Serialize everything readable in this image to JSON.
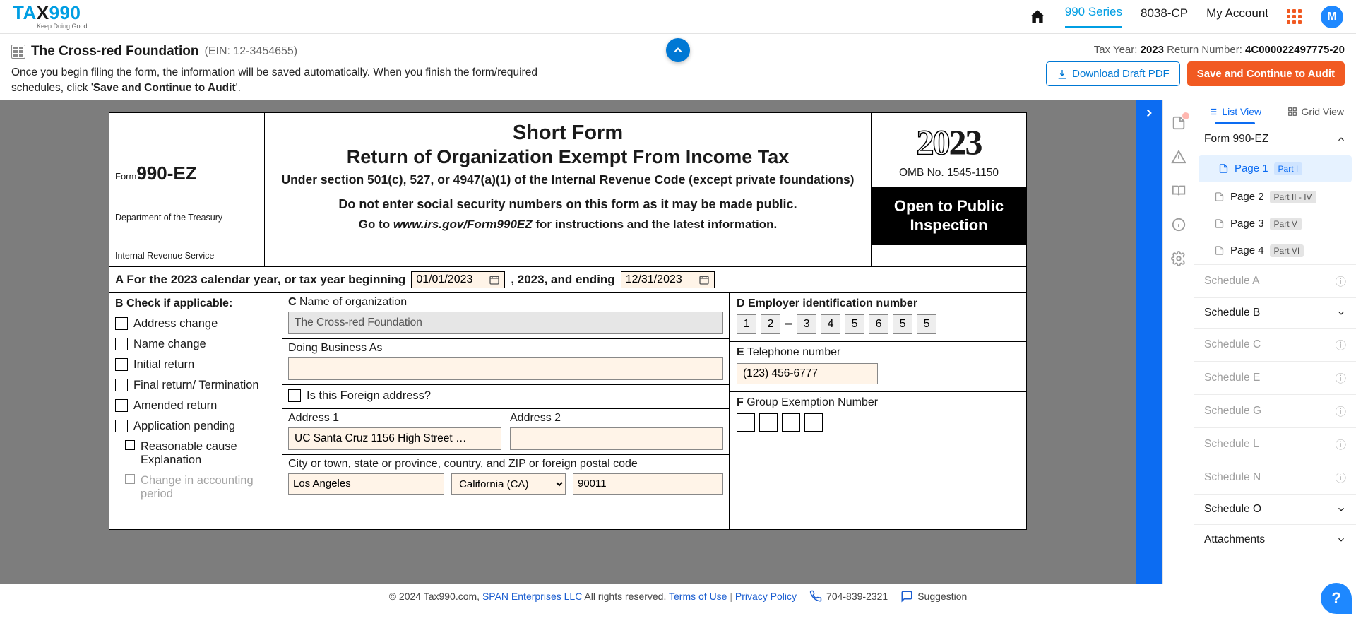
{
  "brand": {
    "name": "TAX990",
    "tagline": "Keep Doing Good"
  },
  "nav": {
    "series": "990 Series",
    "cp": "8038-CP",
    "account": "My Account",
    "avatar_initial": "M"
  },
  "org": {
    "name": "The Cross-red Foundation",
    "ein_display": "(EIN: 12-3454655)"
  },
  "subhead_msg_1": "Once you begin filing the form, the information will be saved automatically. When you finish the form/required schedules, click '",
  "subhead_msg_bold": "Save and Continue to Audit",
  "subhead_msg_2": "'.",
  "meta": {
    "tax_year_label": "Tax Year: ",
    "tax_year": "2023",
    "return_no_label": "  Return Number: ",
    "return_no": "4C000022497775-20"
  },
  "actions": {
    "download": "Download Draft PDF",
    "save": "Save and Continue to Audit"
  },
  "form": {
    "form_label_small": "Form",
    "form_label_big": "990-EZ",
    "dept1": "Department of the Treasury",
    "dept2": "Internal Revenue Service",
    "title1": "Short Form",
    "title2": "Return of Organization Exempt From Income Tax",
    "subtitle": "Under section 501(c), 527, or 4947(a)(1) of the Internal Revenue Code (except private foundations)",
    "warn": "Do not enter social security numbers on this form as it may be made public.",
    "goto_pre": "Go to ",
    "goto_link": "www.irs.gov/Form990EZ",
    "goto_post": " for instructions and the latest information.",
    "year_prefix": "20",
    "year_suffix": "23",
    "omb": "OMB No. 1545-1150",
    "open1": "Open to Public",
    "open2": "Inspection",
    "lineA_pre": "A For the 2023 calendar year, or tax year beginning ",
    "lineA_mid": ", 2023, and ending ",
    "date_begin": "01/01/2023",
    "date_end": "12/31/2023",
    "B": {
      "head": "B Check if applicable:",
      "opts": [
        "Address change",
        "Name change",
        "Initial return",
        "Final return/ Termination",
        "Amended return",
        "Application pending",
        "Reasonable cause Explanation",
        "Change in accounting period"
      ]
    },
    "C": {
      "label": "C",
      "text": " Name of organization",
      "value": "The Cross-red Foundation"
    },
    "dba_label": "Doing Business As",
    "foreign_label": "Is this Foreign address?",
    "addr1_label": "Address 1",
    "addr2_label": "Address 2",
    "addr1_value": "UC Santa Cruz 1156 High Street …",
    "cityline_label": "City or town, state or province, country, and ZIP or foreign postal code",
    "city": "Los Angeles",
    "state": "California (CA)",
    "zip": "90011",
    "D": {
      "label": "D",
      "text": " Employer identification number",
      "digits": [
        "1",
        "2",
        "3",
        "4",
        "5",
        "6",
        "5",
        "5"
      ]
    },
    "E": {
      "label": "E",
      "text": " Telephone number",
      "value": "(123) 456-6777"
    },
    "F": {
      "label": "F",
      "text": " Group Exemption Number"
    }
  },
  "sidebar": {
    "list_view": "List View",
    "grid_view": "Grid View",
    "form_title": "Form 990-EZ",
    "pages": [
      {
        "title": "Page 1",
        "part": "Part I"
      },
      {
        "title": "Page 2",
        "part": "Part II - IV"
      },
      {
        "title": "Page 3",
        "part": "Part V"
      },
      {
        "title": "Page 4",
        "part": "Part VI"
      }
    ],
    "schedules_muted": [
      "Schedule A",
      "Schedule C",
      "Schedule E",
      "Schedule G",
      "Schedule L",
      "Schedule N"
    ],
    "schedule_b": "Schedule B",
    "schedule_o": "Schedule O",
    "attachments": "Attachments"
  },
  "footer": {
    "copyright": "© 2024 Tax990.com, ",
    "span": "SPAN Enterprises LLC",
    "rights": " All rights reserved. ",
    "tou": "Terms of Use",
    "pp": "Privacy Policy",
    "phone": "704-839-2321",
    "suggestion": "Suggestion"
  }
}
